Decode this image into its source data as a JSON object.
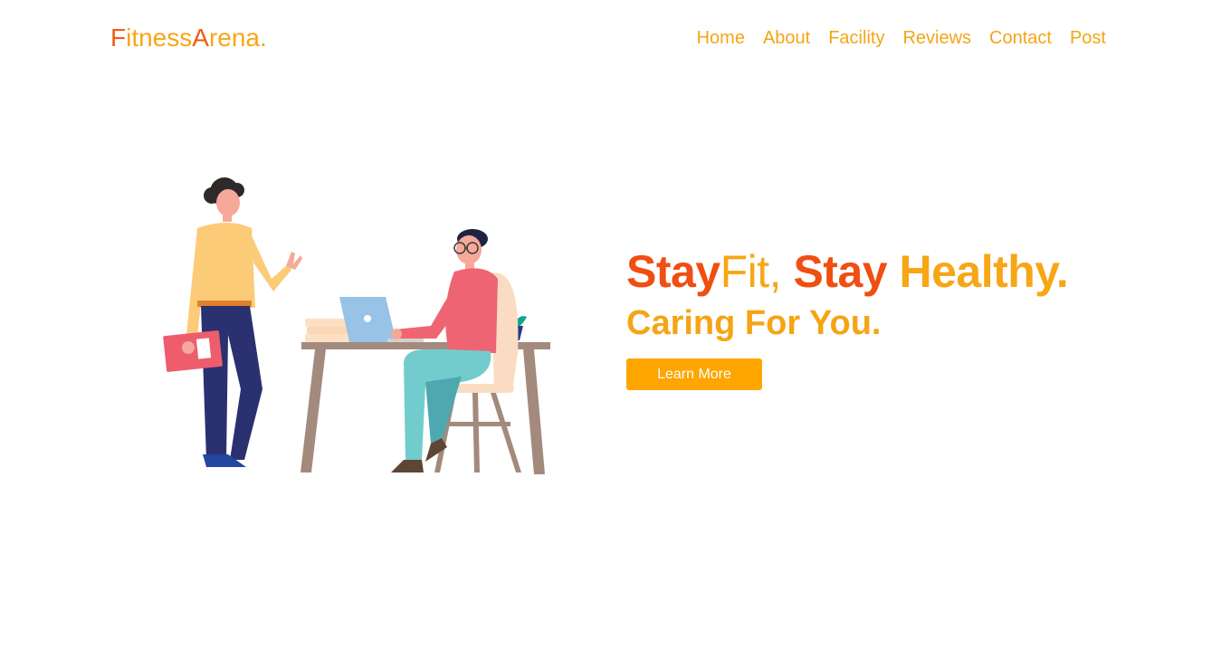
{
  "brand": {
    "part1": "Fitness",
    "part2": "Arena",
    "dot": "."
  },
  "nav": {
    "items": [
      {
        "label": "Home"
      },
      {
        "label": "About"
      },
      {
        "label": "Facility"
      },
      {
        "label": "Reviews"
      },
      {
        "label": "Contact"
      },
      {
        "label": "Post"
      }
    ]
  },
  "hero": {
    "headline_stay1": "Stay",
    "headline_fit": "Fit,",
    "headline_stay2": " Stay ",
    "headline_healthy": "Healthy.",
    "subline": "Caring For You.",
    "cta_label": "Learn More"
  },
  "colors": {
    "accent_orange": "#f04e12",
    "accent_yellow": "#f7a616",
    "button_bg": "#ffa500"
  }
}
